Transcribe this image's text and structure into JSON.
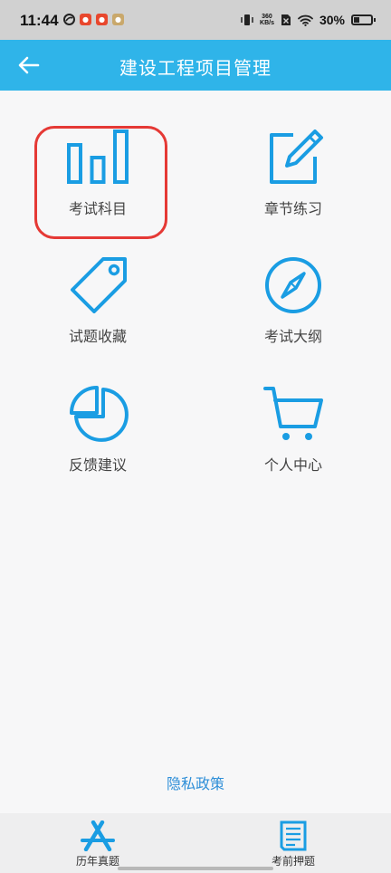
{
  "status_bar": {
    "time": "11:44",
    "net_speed_value": "360",
    "net_speed_unit": "KB/s",
    "battery": "30%"
  },
  "header": {
    "title": "建设工程项目管理",
    "back_icon": "arrow-left-icon"
  },
  "menu": [
    {
      "label": "考试科目",
      "icon": "bar-chart-icon",
      "highlighted": true
    },
    {
      "label": "章节练习",
      "icon": "edit-square-icon"
    },
    {
      "label": "试题收藏",
      "icon": "tag-icon"
    },
    {
      "label": "考试大纲",
      "icon": "compass-icon"
    },
    {
      "label": "反馈建议",
      "icon": "pie-chart-icon"
    },
    {
      "label": "个人中心",
      "icon": "cart-icon"
    }
  ],
  "footer_link": "隐私政策",
  "bottom_nav": [
    {
      "label": "历年真题",
      "icon": "app-store-icon"
    },
    {
      "label": "考前押题",
      "icon": "document-icon"
    }
  ],
  "colors": {
    "accent": "#2fb4e9",
    "icon_blue": "#1a9de3",
    "highlight_red": "#e53935",
    "link_blue": "#2f8fd8"
  }
}
